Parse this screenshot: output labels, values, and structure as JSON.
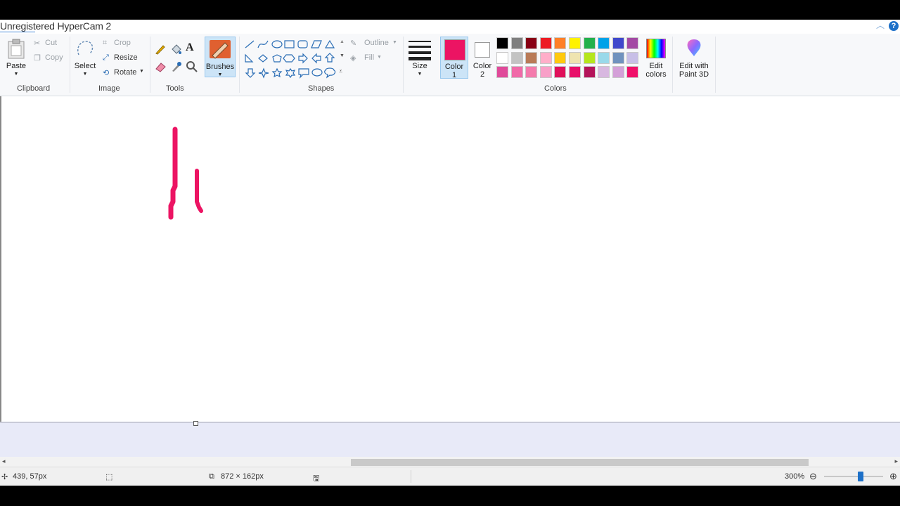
{
  "titlebar": {
    "watermark": "Unregistered HyperCam 2"
  },
  "ribbon": {
    "clipboard": {
      "paste": "Paste",
      "cut": "Cut",
      "copy": "Copy",
      "group": "Clipboard"
    },
    "image": {
      "select": "Select",
      "crop": "Crop",
      "resize": "Resize",
      "rotate": "Rotate",
      "group": "Image"
    },
    "tools": {
      "group": "Tools",
      "brushes": "Brushes"
    },
    "shapes": {
      "outline": "Outline",
      "fill": "Fill",
      "group": "Shapes"
    },
    "size": {
      "label": "Size"
    },
    "color1": {
      "label_line1": "Color",
      "label_line2": "1",
      "color": "#ec1463"
    },
    "color2": {
      "label_line1": "Color",
      "label_line2": "2",
      "color": "#ffffff"
    },
    "colors": {
      "group": "Colors",
      "row1": [
        "#000000",
        "#7f7f7f",
        "#880015",
        "#ed1c24",
        "#ff7f27",
        "#fff200",
        "#22b14c",
        "#00a2e8",
        "#3f48cc",
        "#a349a4"
      ],
      "row2": [
        "#ffffff",
        "#c3c3c3",
        "#b97a57",
        "#ffaec9",
        "#ffc90e",
        "#efe4b0",
        "#b5e61d",
        "#99d9ea",
        "#7092be",
        "#c8bfe7"
      ],
      "row3": [
        "#e04a9a",
        "#f06aa8",
        "#f47aac",
        "#f8a0c8",
        "#e0105a",
        "#e8106a",
        "#b4145a",
        "#d8b8e0",
        "#d4a0d8",
        "#f0106a"
      ]
    },
    "edit_colors": {
      "line1": "Edit",
      "line2": "colors"
    },
    "edit_paint3d": {
      "line1": "Edit with",
      "line2": "Paint 3D"
    }
  },
  "statusbar": {
    "cursor_pos": "439, 57px",
    "canvas_size": "872 × 162px",
    "zoom": "300%",
    "zoom_fraction": 0.62
  }
}
